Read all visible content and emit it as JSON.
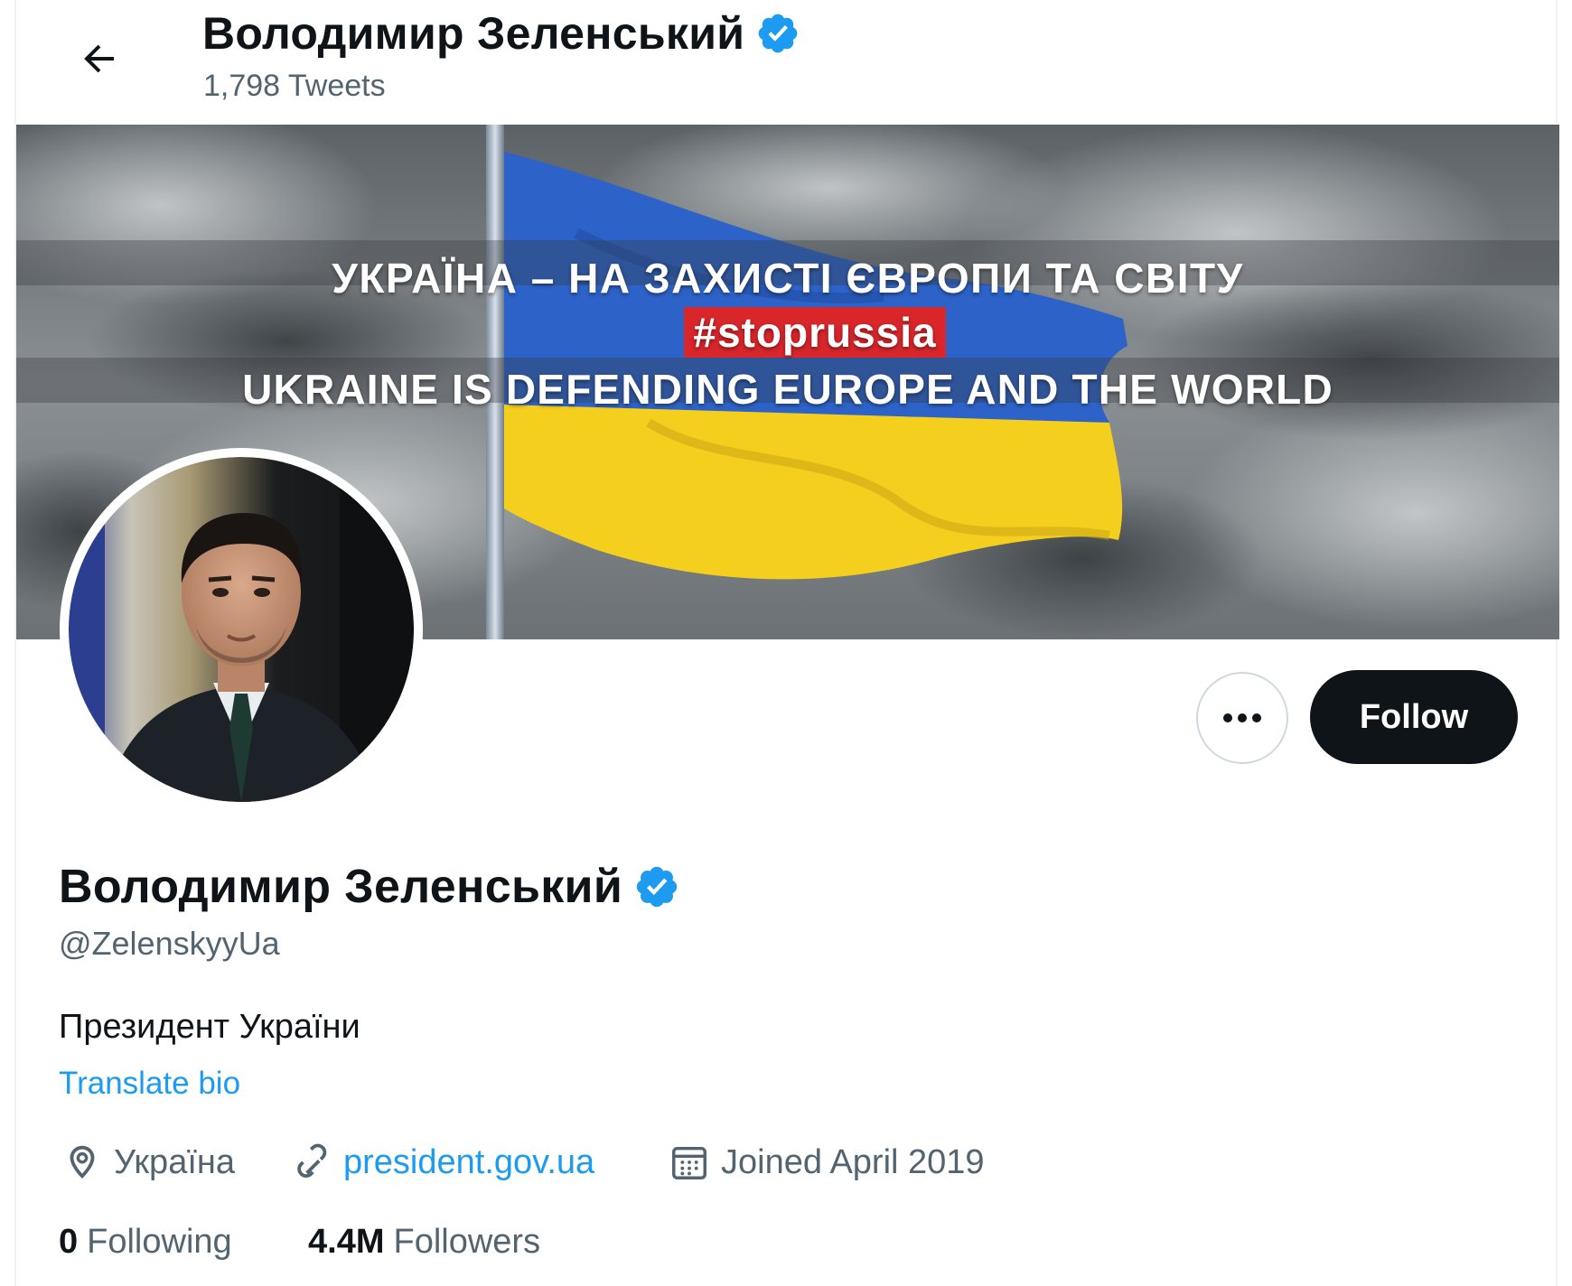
{
  "header": {
    "title": "Володимир Зеленський",
    "tweet_count": "1,798 Tweets"
  },
  "banner": {
    "line1": "УКРАЇНА – НА ЗАХИСТІ ЄВРОПИ ТА СВІТУ",
    "hashtag": "#stoprussia",
    "line3": "UKRAINE IS DEFENDING EUROPE AND THE WORLD"
  },
  "actions": {
    "more_label": "•••",
    "follow_label": "Follow"
  },
  "profile": {
    "name": "Володимир Зеленський",
    "handle": "@ZelenskyyUa",
    "bio": "Президент України",
    "translate_bio": "Translate bio",
    "location": "Україна",
    "website": "president.gov.ua",
    "joined": "Joined April 2019",
    "following_count": "0",
    "following_label": "Following",
    "followers_count": "4.4M",
    "followers_label": "Followers"
  },
  "colors": {
    "accent": "#1d9bf0",
    "text": "#0f1419",
    "muted": "#536471",
    "flag_blue": "#2d63c8",
    "flag_yellow": "#f5cf1d",
    "hashtag_bg": "#d8262b"
  },
  "icons": [
    "back-arrow-icon",
    "verified-badge-icon",
    "more-icon",
    "location-icon",
    "link-icon",
    "calendar-icon"
  ]
}
